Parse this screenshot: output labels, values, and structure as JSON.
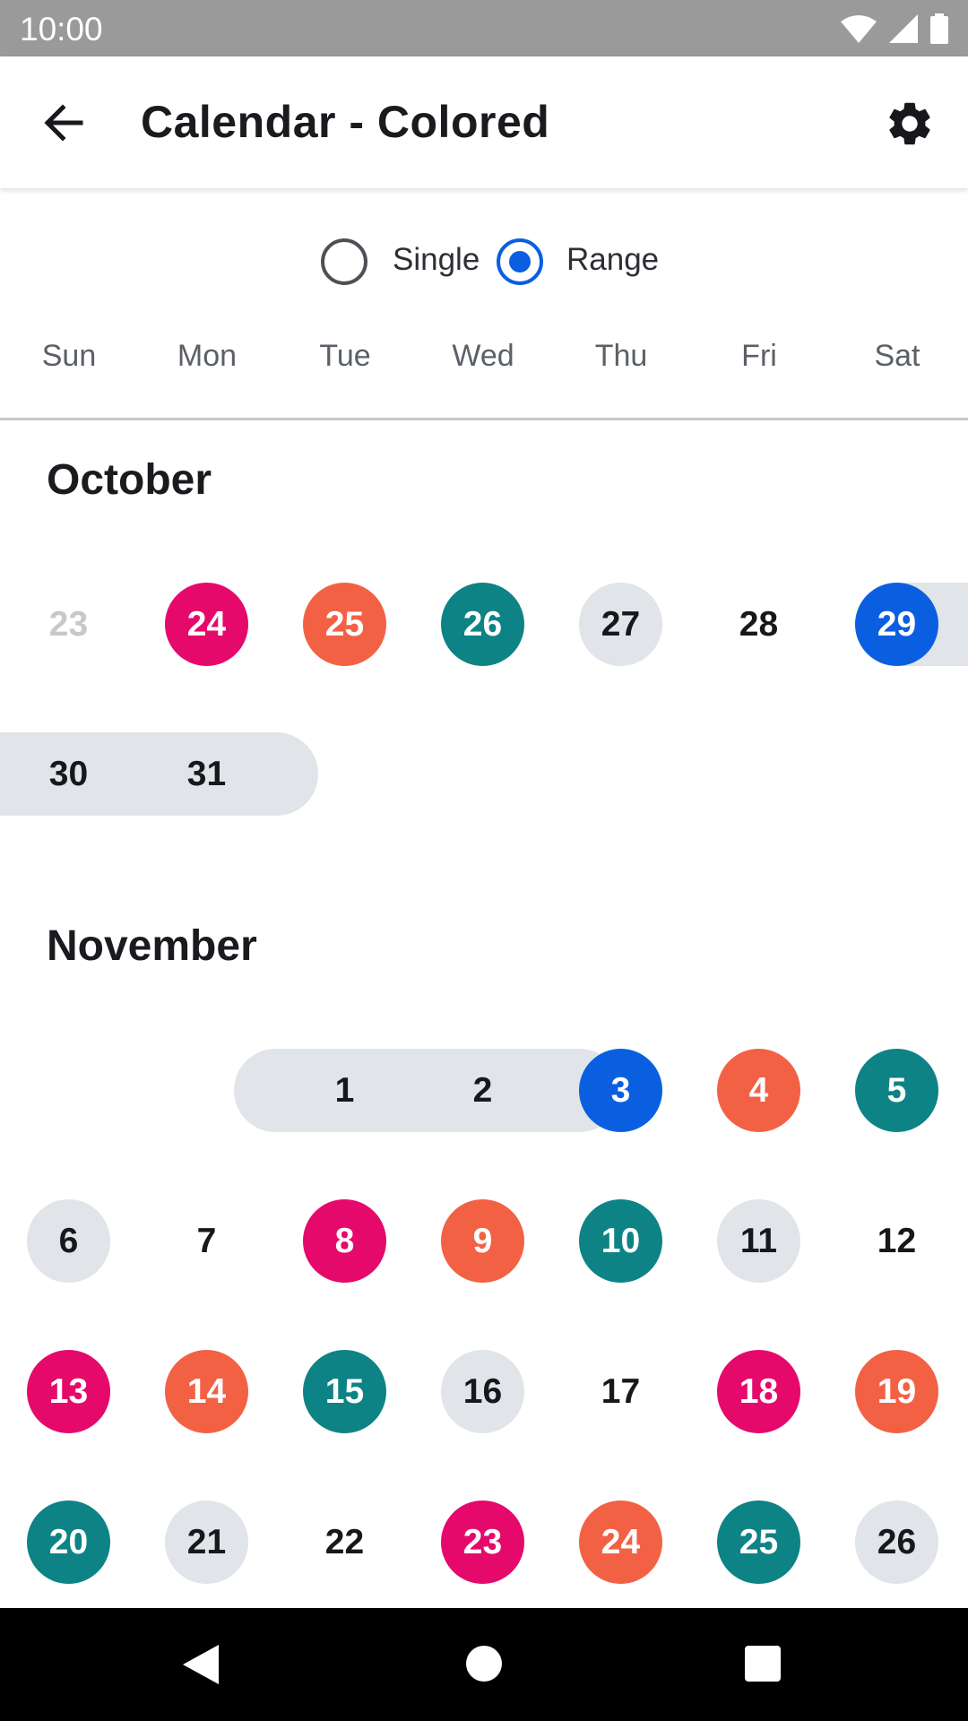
{
  "status_bar": {
    "time": "10:00",
    "icons": [
      "wifi-icon",
      "signal-icon",
      "battery-icon"
    ]
  },
  "app_bar": {
    "title": "Calendar - Colored",
    "back_icon": "arrow-left-icon",
    "settings_icon": "gear-icon"
  },
  "selection_mode": {
    "options": [
      {
        "label": "Single",
        "selected": false
      },
      {
        "label": "Range",
        "selected": true
      }
    ]
  },
  "weekdays": [
    "Sun",
    "Mon",
    "Tue",
    "Wed",
    "Thu",
    "Fri",
    "Sat"
  ],
  "colors": {
    "magenta": "#e5096c",
    "orange": "#f36145",
    "teal": "#0e8385",
    "gray": "#e1e4e8",
    "blue": "#0a5fe0"
  },
  "months": [
    {
      "name": "October",
      "weeks": [
        [
          {
            "day": "23",
            "style": "faded"
          },
          {
            "day": "24",
            "style": "magenta"
          },
          {
            "day": "25",
            "style": "orange"
          },
          {
            "day": "26",
            "style": "teal"
          },
          {
            "day": "27",
            "style": "gray"
          },
          {
            "day": "28",
            "style": "plain"
          },
          {
            "day": "29",
            "style": "blue"
          }
        ],
        [
          {
            "day": "30",
            "style": "range"
          },
          {
            "day": "31",
            "style": "range"
          }
        ]
      ]
    },
    {
      "name": "November",
      "weeks": [
        [
          null,
          null,
          {
            "day": "1",
            "style": "range"
          },
          {
            "day": "2",
            "style": "range"
          },
          {
            "day": "3",
            "style": "blue"
          },
          {
            "day": "4",
            "style": "orange"
          },
          {
            "day": "5",
            "style": "teal"
          }
        ],
        [
          {
            "day": "6",
            "style": "gray"
          },
          {
            "day": "7",
            "style": "plain"
          },
          {
            "day": "8",
            "style": "magenta"
          },
          {
            "day": "9",
            "style": "orange"
          },
          {
            "day": "10",
            "style": "teal"
          },
          {
            "day": "11",
            "style": "gray"
          },
          {
            "day": "12",
            "style": "plain"
          }
        ],
        [
          {
            "day": "13",
            "style": "magenta"
          },
          {
            "day": "14",
            "style": "orange"
          },
          {
            "day": "15",
            "style": "teal"
          },
          {
            "day": "16",
            "style": "gray"
          },
          {
            "day": "17",
            "style": "plain"
          },
          {
            "day": "18",
            "style": "magenta"
          },
          {
            "day": "19",
            "style": "orange"
          }
        ],
        [
          {
            "day": "20",
            "style": "teal"
          },
          {
            "day": "21",
            "style": "gray"
          },
          {
            "day": "22",
            "style": "plain"
          },
          {
            "day": "23",
            "style": "magenta"
          },
          {
            "day": "24",
            "style": "orange"
          },
          {
            "day": "25",
            "style": "teal"
          },
          {
            "day": "26",
            "style": "gray"
          }
        ]
      ]
    }
  ],
  "nav_bar": {
    "icons": [
      "back-triangle-icon",
      "home-circle-icon",
      "recents-square-icon"
    ]
  }
}
